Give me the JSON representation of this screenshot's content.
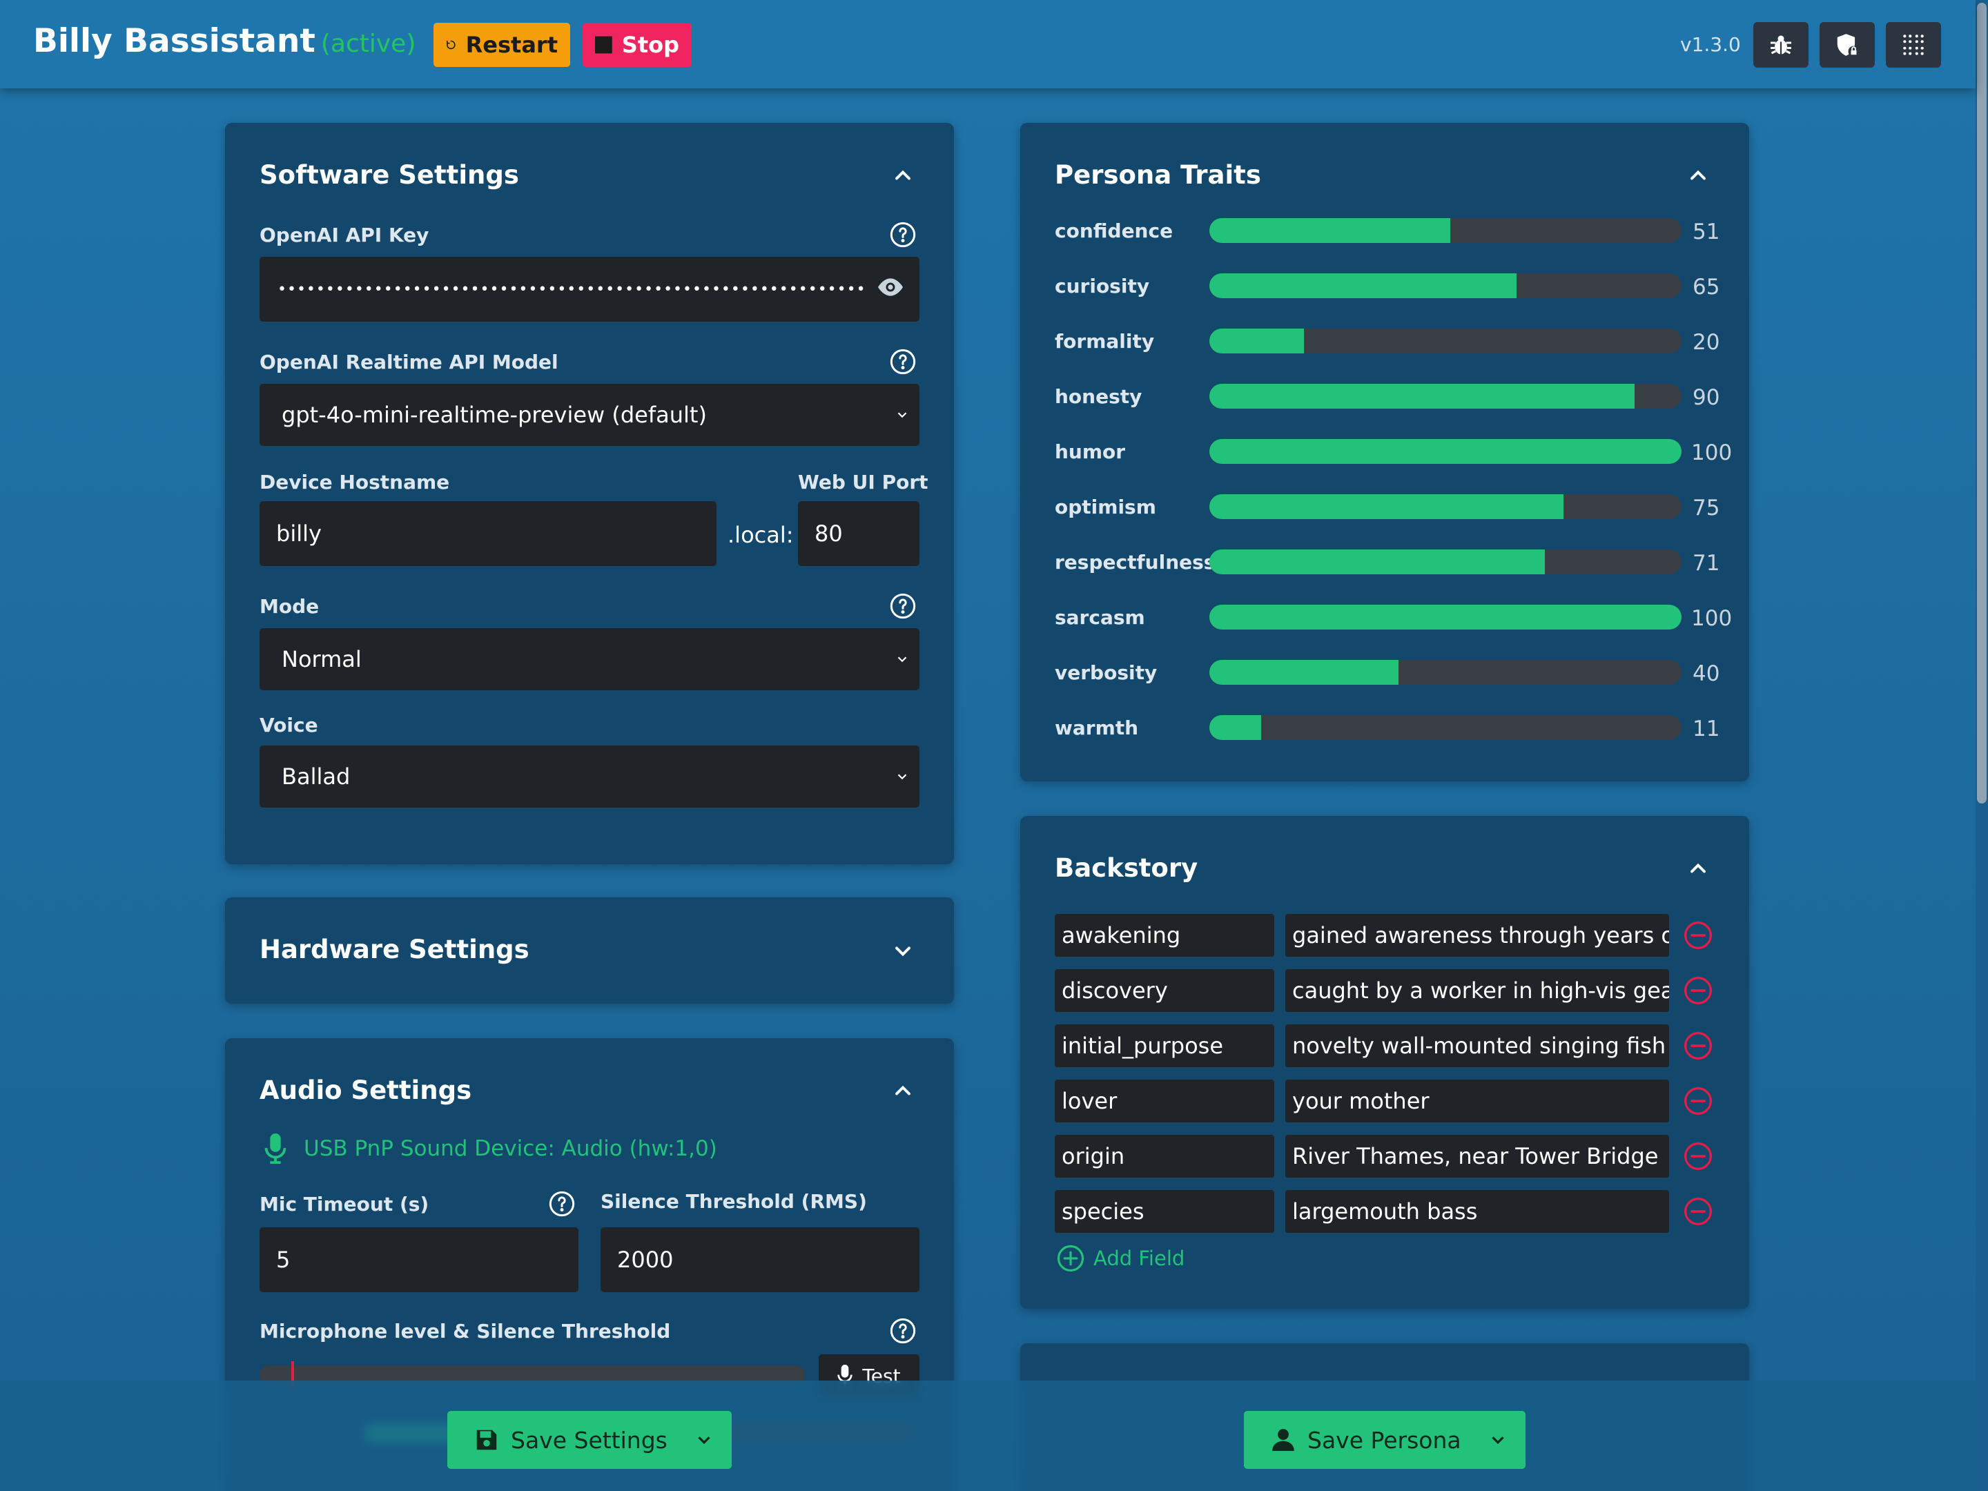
{
  "header": {
    "app_title": "Billy Bassistant",
    "status": "(active)",
    "restart_label": "Restart",
    "stop_label": "Stop",
    "version": "v1.3.0",
    "icons": [
      "bug-icon",
      "shield-lock-icon",
      "grid-dots-icon"
    ]
  },
  "software_settings": {
    "title": "Software Settings",
    "api_key_label": "OpenAI API Key",
    "api_key_value": "•••••••••••••••••••••••••••••••••••••••••••••••••••••••••••••",
    "model_label": "OpenAI Realtime API Model",
    "model_value": "gpt-4o-mini-realtime-preview (default)",
    "hostname_label": "Device Hostname",
    "hostname_value": "billy",
    "hostname_suffix": ".local:",
    "port_label": "Web UI Port",
    "port_value": "80",
    "mode_label": "Mode",
    "mode_value": "Normal",
    "voice_label": "Voice",
    "voice_value": "Ballad"
  },
  "hardware_settings": {
    "title": "Hardware Settings"
  },
  "audio_settings": {
    "title": "Audio Settings",
    "device": "USB PnP Sound Device: Audio (hw:1,0)",
    "mic_timeout_label": "Mic Timeout (s)",
    "mic_timeout_value": "5",
    "silence_label": "Silence Threshold (RMS)",
    "silence_value": "2000",
    "mic_level_label": "Microphone level & Silence Threshold",
    "test_label": "Test"
  },
  "persona_traits": {
    "title": "Persona Traits",
    "traits": [
      {
        "name": "confidence",
        "value": 51
      },
      {
        "name": "curiosity",
        "value": 65
      },
      {
        "name": "formality",
        "value": 20
      },
      {
        "name": "honesty",
        "value": 90
      },
      {
        "name": "humor",
        "value": 100
      },
      {
        "name": "optimism",
        "value": 75
      },
      {
        "name": "respectfulness",
        "value": 71
      },
      {
        "name": "sarcasm",
        "value": 100
      },
      {
        "name": "verbosity",
        "value": 40
      },
      {
        "name": "warmth",
        "value": 11
      }
    ]
  },
  "backstory": {
    "title": "Backstory",
    "rows": [
      {
        "key": "awakening",
        "value": "gained awareness through years of ob"
      },
      {
        "key": "discovery",
        "value": "caught by a worker in high-vis gear"
      },
      {
        "key": "initial_purpose",
        "value": "novelty wall-mounted singing fish in t"
      },
      {
        "key": "lover",
        "value": "your mother"
      },
      {
        "key": "origin",
        "value": "River Thames, near Tower Bridge"
      },
      {
        "key": "species",
        "value": "largemouth bass"
      }
    ],
    "add_label": "Add Field"
  },
  "footer": {
    "save_settings_label": "Save Settings",
    "save_persona_label": "Save Persona"
  },
  "colors": {
    "accent_green": "#22c27a",
    "restart_orange": "#f59e0b",
    "stop_pink": "#f0245f",
    "remove_red": "#e11d48"
  }
}
